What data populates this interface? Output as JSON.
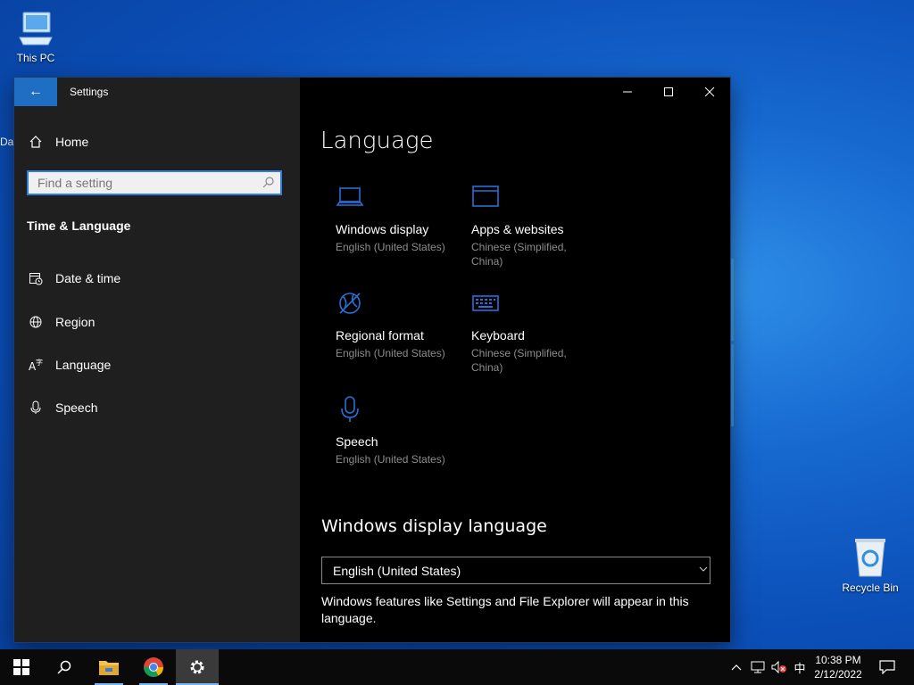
{
  "desktop": {
    "this_pc": "This PC",
    "recycle_bin": "Recycle Bin",
    "stub_label": "Da"
  },
  "window": {
    "title": "Settings",
    "back_glyph": "←"
  },
  "sidebar": {
    "home": "Home",
    "search_placeholder": "Find a setting",
    "section": "Time & Language",
    "items": [
      {
        "label": "Date & time",
        "icon": "calendar-clock-icon"
      },
      {
        "label": "Region",
        "icon": "globe-icon"
      },
      {
        "label": "Language",
        "icon": "language-icon"
      },
      {
        "label": "Speech",
        "icon": "microphone-icon"
      }
    ]
  },
  "main": {
    "title": "Language",
    "tiles": [
      {
        "title": "Windows display",
        "subtitle": "English (United States)",
        "icon": "laptop-icon"
      },
      {
        "title": "Apps & websites",
        "subtitle": "Chinese (Simplified, China)",
        "icon": "browser-window-icon"
      },
      {
        "title": "Regional format",
        "subtitle": "English (United States)",
        "icon": "regional-globe-icon"
      },
      {
        "title": "Keyboard",
        "subtitle": "Chinese (Simplified, China)",
        "icon": "keyboard-icon"
      },
      {
        "title": "Speech",
        "subtitle": "English (United States)",
        "icon": "microphone-icon"
      }
    ],
    "display_language_heading": "Windows display language",
    "display_language_value": "English (United States)",
    "display_language_description": "Windows features like Settings and File Explorer will appear in this language."
  },
  "taskbar": {
    "clock_time": "10:38 PM",
    "clock_date": "2/12/2022",
    "ime": "中"
  },
  "colors": {
    "accent": "#1e6fc3",
    "icon_blue": "#2a6fd6"
  }
}
